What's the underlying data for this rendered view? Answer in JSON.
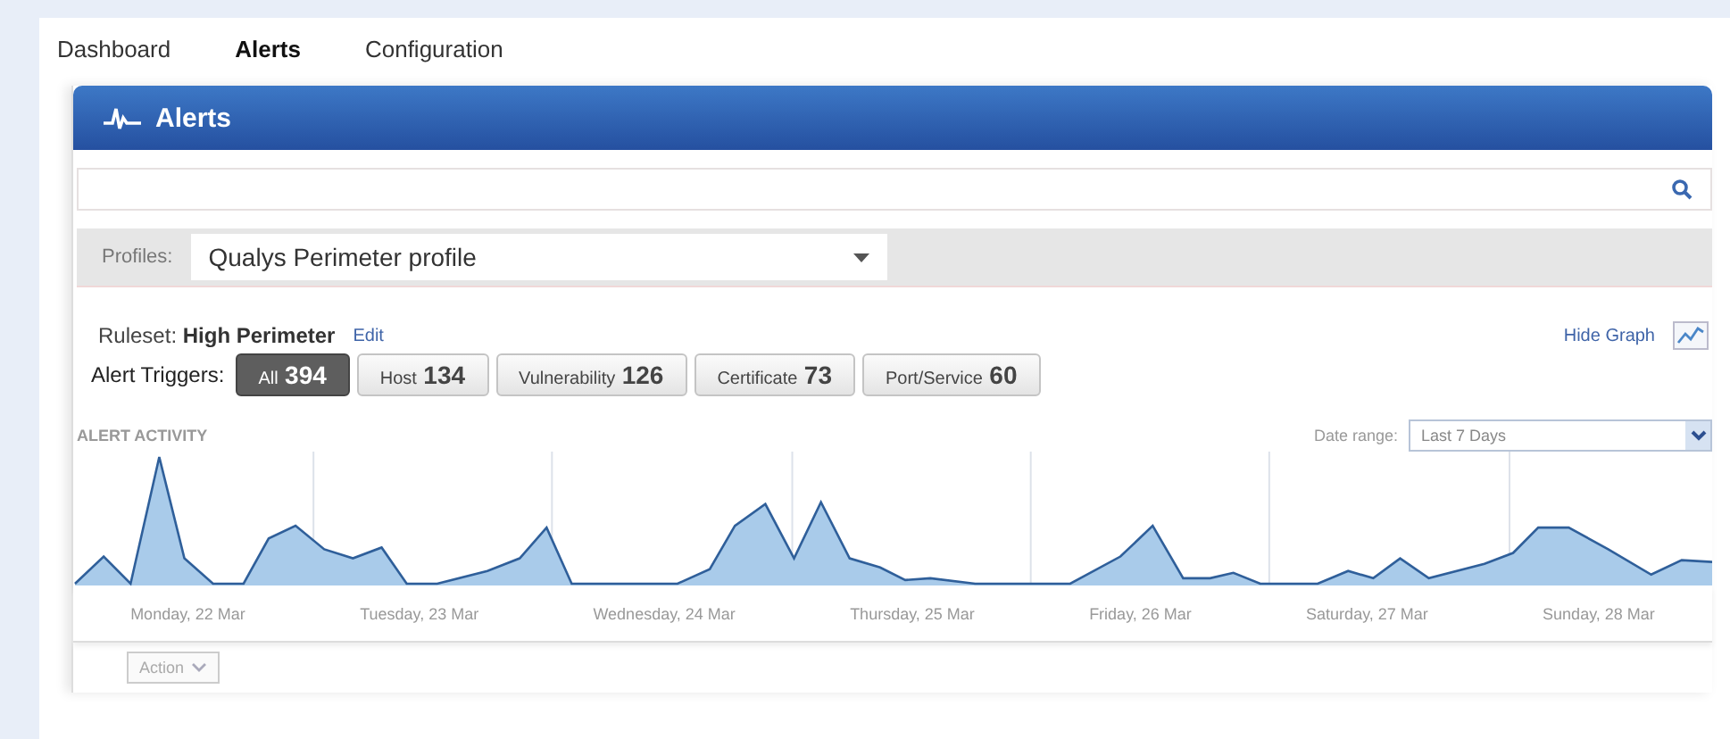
{
  "tabs": [
    {
      "label": "Dashboard",
      "selected": false
    },
    {
      "label": "Alerts",
      "selected": true
    },
    {
      "label": "Configuration",
      "selected": false
    }
  ],
  "panel": {
    "title": "Alerts"
  },
  "profiles": {
    "label": "Profiles:",
    "value": "Qualys Perimeter profile"
  },
  "ruleset": {
    "label": "Ruleset:",
    "name": "High Perimeter",
    "edit": "Edit"
  },
  "hide_graph": "Hide Graph",
  "triggers": {
    "label": "Alert Triggers:",
    "items": [
      {
        "label": "All",
        "count": "394",
        "selected": true
      },
      {
        "label": "Host",
        "count": "134",
        "selected": false
      },
      {
        "label": "Vulnerability",
        "count": "126",
        "selected": false
      },
      {
        "label": "Certificate",
        "count": "73",
        "selected": false
      },
      {
        "label": "Port/Service",
        "count": "60",
        "selected": false
      }
    ]
  },
  "activity": {
    "title": "ALERT ACTIVITY",
    "date_range_label": "Date range:",
    "date_range_value": "Last 7 Days",
    "day_labels": [
      "Monday, 22 Mar",
      "Tuesday, 23 Mar",
      "Wednesday, 24 Mar",
      "Thursday, 25 Mar",
      "Friday, 26 Mar",
      "Saturday, 27 Mar",
      "Sunday, 28 Mar"
    ]
  },
  "action_button": "Action"
}
